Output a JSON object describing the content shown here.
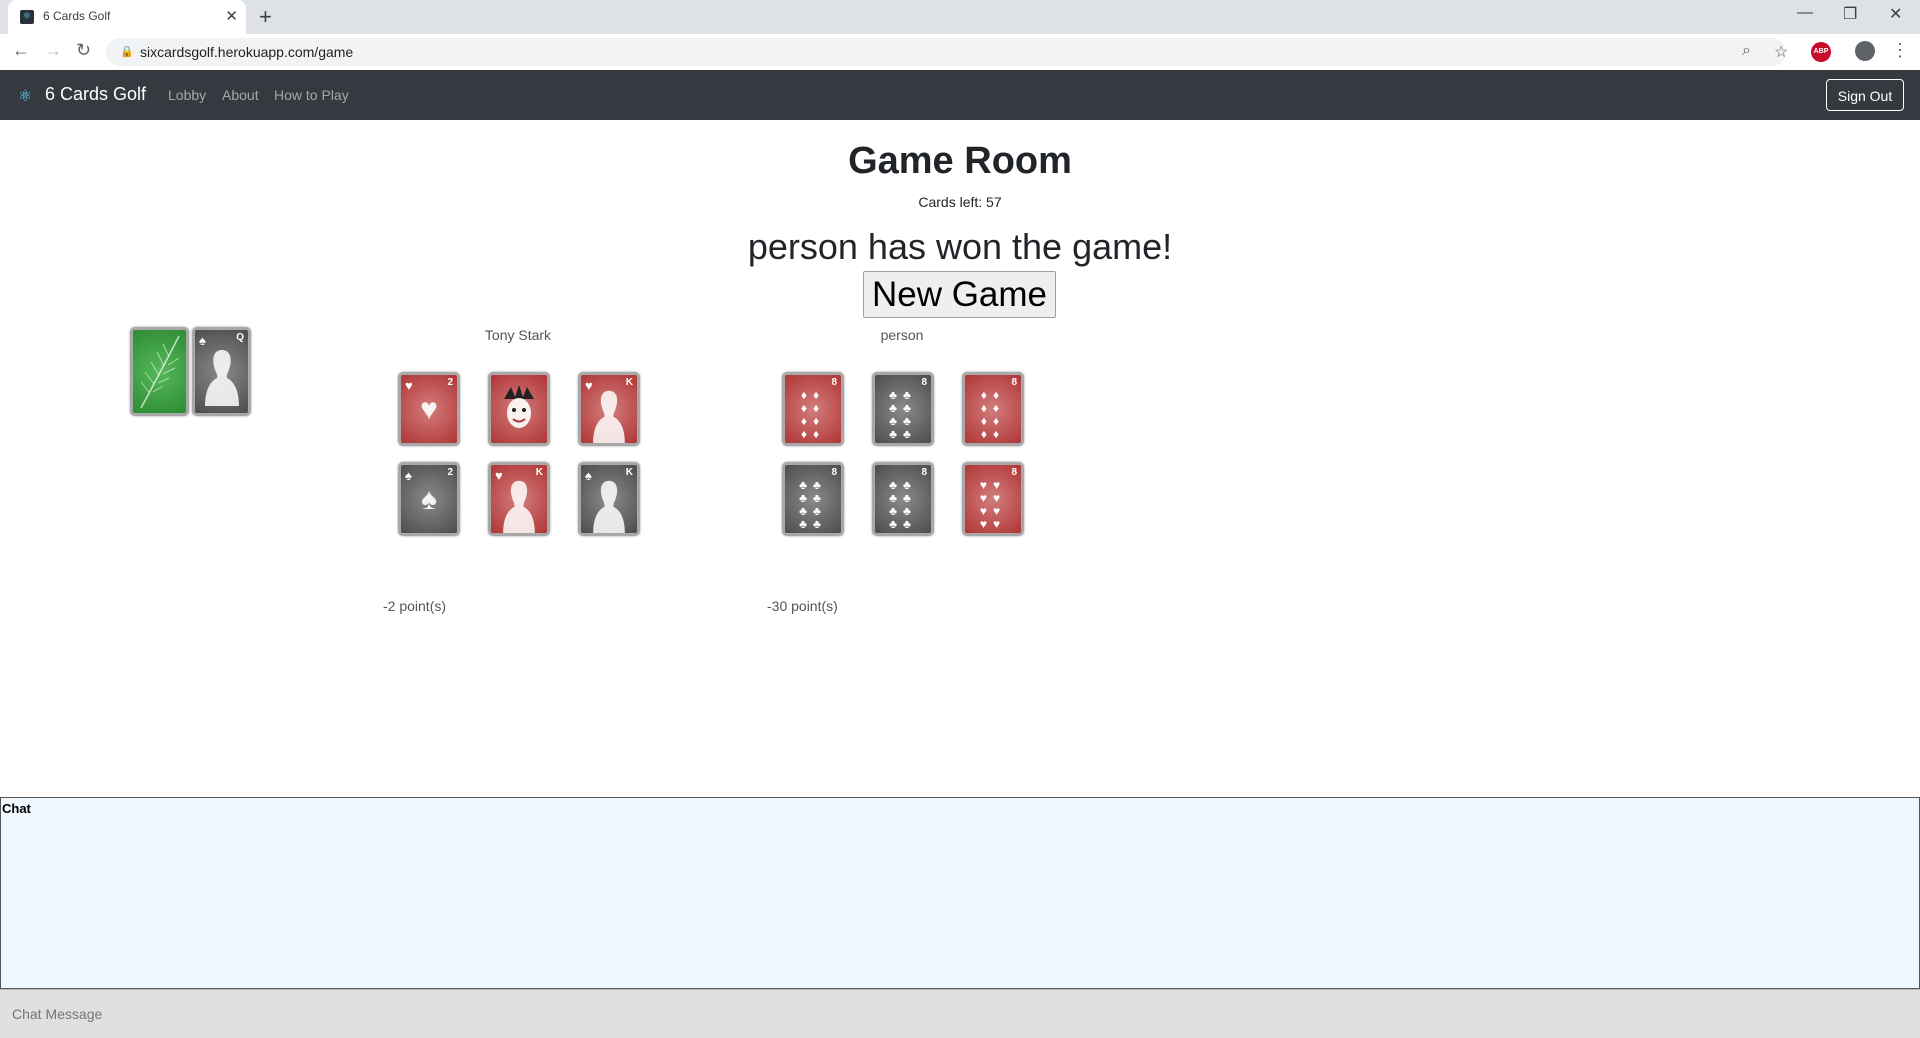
{
  "browser": {
    "tab_title": "6 Cards Golf",
    "url": "sixcardsgolf.herokuapp.com/game",
    "new_tab": "+",
    "close": "✕"
  },
  "navbar": {
    "brand": "6 Cards Golf",
    "links": [
      "Lobby",
      "About",
      "How to Play"
    ],
    "signout": "Sign Out"
  },
  "game": {
    "title": "Game Room",
    "cards_left": "Cards left: 57",
    "winner_message": "person has won the game!",
    "new_game_label": "New Game",
    "deck": {
      "discard_top": {
        "rank": "Q",
        "suit": "♠",
        "color": "black"
      }
    },
    "players": [
      {
        "name": "Tony Stark",
        "points": "-2 point(s)",
        "cards": [
          {
            "rank": "2",
            "suit": "♥",
            "color": "red"
          },
          {
            "rank": "",
            "suit": "",
            "color": "red",
            "face": "joker"
          },
          {
            "rank": "K",
            "suit": "♥",
            "color": "red"
          },
          {
            "rank": "2",
            "suit": "♠",
            "color": "black"
          },
          {
            "rank": "K",
            "suit": "♥",
            "color": "red"
          },
          {
            "rank": "K",
            "suit": "♠",
            "color": "black"
          }
        ]
      },
      {
        "name": "person",
        "points": "-30 point(s)",
        "cards": [
          {
            "rank": "8",
            "suit": "♦",
            "color": "red"
          },
          {
            "rank": "8",
            "suit": "♣",
            "color": "black"
          },
          {
            "rank": "8",
            "suit": "♦",
            "color": "red"
          },
          {
            "rank": "8",
            "suit": "♣",
            "color": "black"
          },
          {
            "rank": "8",
            "suit": "♣",
            "color": "black"
          },
          {
            "rank": "8",
            "suit": "♥",
            "color": "red"
          }
        ]
      }
    ]
  },
  "chat": {
    "title": "Chat",
    "placeholder": "Chat Message"
  }
}
